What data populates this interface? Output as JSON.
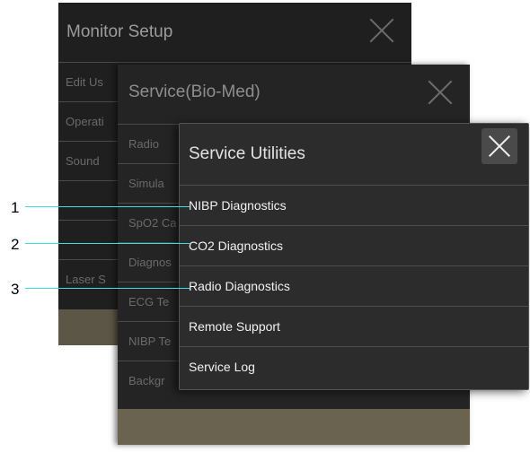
{
  "monitor_setup": {
    "title": "Monitor Setup",
    "items": [
      "Edit Us",
      "Operati",
      "Sound",
      "",
      "",
      "Laser S"
    ]
  },
  "service_biomed": {
    "title": "Service(Bio-Med)",
    "items": [
      "Radio",
      "Simula",
      "SpO2 Ca",
      "Diagnos",
      "ECG Te",
      "NIBP Te",
      "Backgr"
    ]
  },
  "service_utilities": {
    "title": "Service Utilities",
    "items": [
      {
        "label": "NIBP Diagnostics"
      },
      {
        "label": "CO2 Diagnostics"
      },
      {
        "label": "Radio Diagnostics"
      },
      {
        "label": "Remote Support"
      },
      {
        "label": "Service Log"
      }
    ]
  },
  "callouts": [
    "1",
    "2",
    "3"
  ],
  "colors": {
    "callout_line": "#39e0e0",
    "footer_bar": "#6a6350",
    "panel_bg": "#2c2c2c"
  }
}
